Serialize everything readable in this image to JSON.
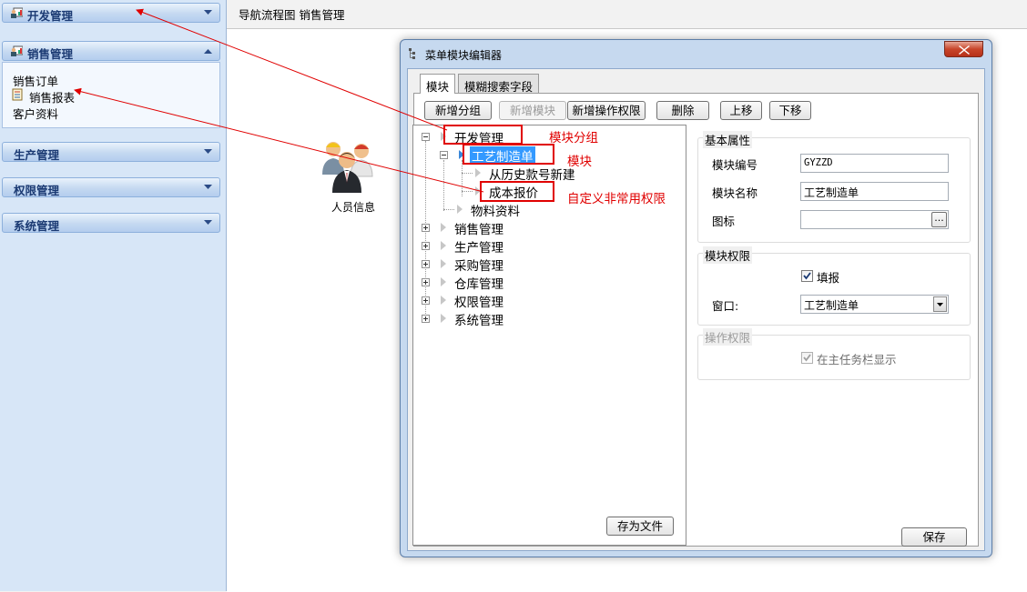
{
  "sidebar": {
    "sections": [
      {
        "label": "开发管理",
        "icon": "person-chart-icon",
        "state": "collapsed"
      },
      {
        "label": "销售管理",
        "icon": "person-chart-icon",
        "state": "expanded"
      },
      {
        "label": "生产管理",
        "state": "collapsed"
      },
      {
        "label": "权限管理",
        "state": "collapsed"
      },
      {
        "label": "系统管理",
        "state": "collapsed"
      }
    ],
    "sales_items": [
      "销售订单",
      "销售报表",
      "客户资料"
    ]
  },
  "breadcrumb": "导航流程图  销售管理",
  "desktop_icon": {
    "label": "人员信息",
    "icon": "people-group-icon"
  },
  "dialog": {
    "title": "菜单模块编辑器",
    "tabs": [
      "模块",
      "模糊搜索字段"
    ],
    "toolbar": {
      "add_group": "新增分组",
      "add_module": "新增模块",
      "add_permission": "新增操作权限",
      "delete": "删除",
      "move_up": "上移",
      "move_down": "下移"
    },
    "tree": {
      "root_dev": "开发管理",
      "craft_order": "工艺制造单",
      "from_history": "从历史款号新建",
      "cost_quote": "成本报价",
      "materials": "物料资料",
      "sales": "销售管理",
      "production": "生产管理",
      "purchase": "采购管理",
      "warehouse": "仓库管理",
      "permission": "权限管理",
      "system": "系统管理"
    },
    "save_to_file": "存为文件",
    "basic": {
      "title": "基本属性",
      "code_label": "模块编号",
      "code_value": "GYZZD",
      "name_label": "模块名称",
      "name_value": "工艺制造单",
      "icon_label": "图标",
      "icon_value": "",
      "browse": "..."
    },
    "perm": {
      "title": "模块权限",
      "fill_label": "填报",
      "fill_checked": true,
      "window_label": "窗口:",
      "window_value": "工艺制造单"
    },
    "ops": {
      "title": "操作权限",
      "taskbar_label": "在主任务栏显示",
      "taskbar_checked": true
    },
    "save": "保存"
  },
  "annotations": {
    "group": "模块分组",
    "module": "模块",
    "custom": "自定义非常用权限"
  },
  "colors": {
    "annotation": "#e00000",
    "sidebar_bg": "#d7e6f7",
    "selection": "#3399ff"
  }
}
